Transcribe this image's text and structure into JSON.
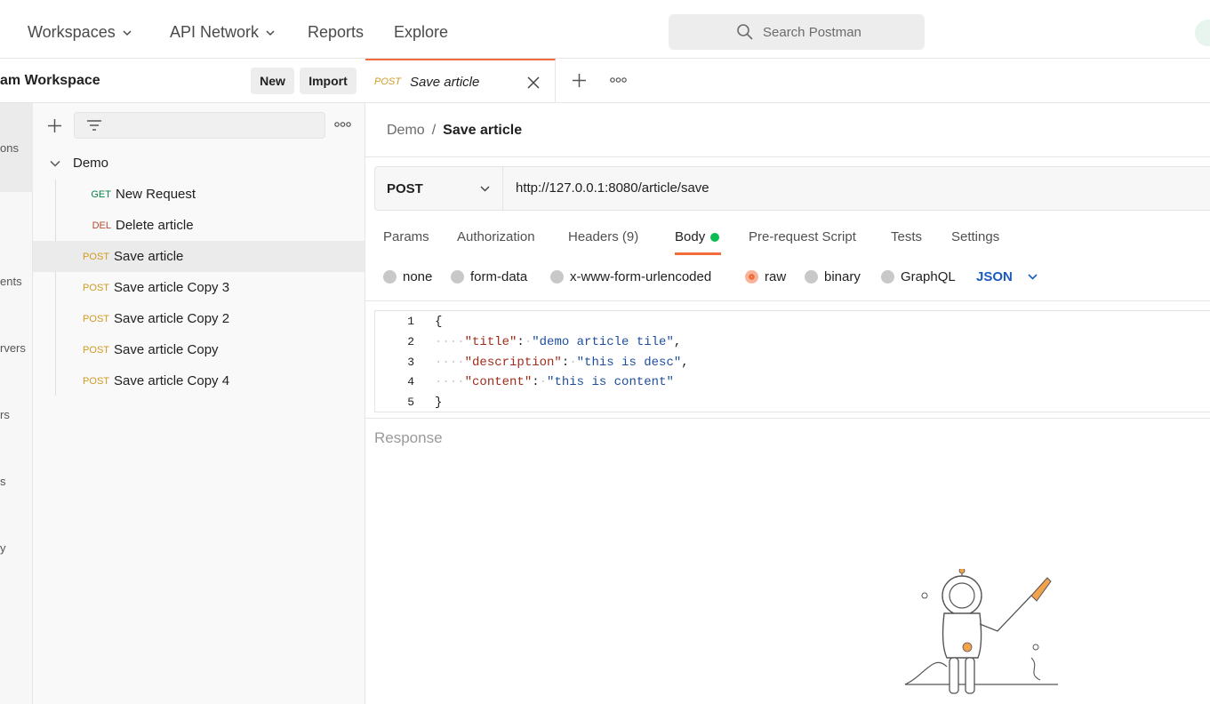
{
  "topnav": {
    "items": [
      {
        "label": "Workspaces",
        "dropdown": true
      },
      {
        "label": "API Network",
        "dropdown": true
      },
      {
        "label": "Reports",
        "dropdown": false
      },
      {
        "label": "Explore",
        "dropdown": false
      }
    ],
    "search_placeholder": "Search Postman"
  },
  "workspace": {
    "title": "am Workspace",
    "new_label": "New",
    "import_label": "Import"
  },
  "rail": {
    "labels": [
      "ons",
      "ents",
      "rvers",
      "rs",
      "s",
      "y"
    ]
  },
  "tree": {
    "collection": "Demo",
    "requests": [
      {
        "method": "GET",
        "name": "New Request",
        "selected": false
      },
      {
        "method": "DEL",
        "name": "Delete article",
        "selected": false
      },
      {
        "method": "POST",
        "name": "Save article",
        "selected": true
      },
      {
        "method": "POST",
        "name": "Save article Copy 3",
        "selected": false
      },
      {
        "method": "POST",
        "name": "Save article Copy 2",
        "selected": false
      },
      {
        "method": "POST",
        "name": "Save article Copy",
        "selected": false
      },
      {
        "method": "POST",
        "name": "Save article Copy 4",
        "selected": false
      }
    ]
  },
  "open_tab": {
    "method": "POST",
    "name": "Save article"
  },
  "breadcrumb": {
    "parent": "Demo",
    "separator": "/",
    "current": "Save article"
  },
  "request": {
    "method": "POST",
    "url": "http://127.0.0.1:8080/article/save"
  },
  "request_tabs": [
    "Params",
    "Authorization",
    "Headers (9)",
    "Body",
    "Pre-request Script",
    "Tests",
    "Settings"
  ],
  "active_request_tab": "Body",
  "body_modes": [
    "none",
    "form-data",
    "x-www-form-urlencoded",
    "raw",
    "binary",
    "GraphQL"
  ],
  "active_body_mode": "raw",
  "body_language": "JSON",
  "editor": {
    "line_numbers": [
      "1",
      "2",
      "3",
      "4",
      "5"
    ],
    "lines": [
      {
        "parts": [
          {
            "t": "p",
            "v": "{"
          }
        ]
      },
      {
        "parts": [
          {
            "t": "w",
            "v": "····"
          },
          {
            "t": "k",
            "v": "\"title\""
          },
          {
            "t": "p",
            "v": ":"
          },
          {
            "t": "w",
            "v": "·"
          },
          {
            "t": "s",
            "v": "\"demo article tile\""
          },
          {
            "t": "p",
            "v": ","
          }
        ]
      },
      {
        "parts": [
          {
            "t": "w",
            "v": "····"
          },
          {
            "t": "k",
            "v": "\"description\""
          },
          {
            "t": "p",
            "v": ":"
          },
          {
            "t": "w",
            "v": "·"
          },
          {
            "t": "s",
            "v": "\"this is desc\""
          },
          {
            "t": "p",
            "v": ","
          }
        ]
      },
      {
        "parts": [
          {
            "t": "w",
            "v": "····"
          },
          {
            "t": "k",
            "v": "\"content\""
          },
          {
            "t": "p",
            "v": ":"
          },
          {
            "t": "w",
            "v": "·"
          },
          {
            "t": "s",
            "v": "\"this is content\""
          }
        ]
      },
      {
        "parts": [
          {
            "t": "p",
            "v": "}"
          }
        ]
      }
    ]
  },
  "response_label": "Response",
  "colors": {
    "accent": "#f26b3a",
    "get": "#0c7b45",
    "del": "#b64a2f",
    "post": "#d09b22",
    "json_link": "#1a5bbf",
    "body_dot": "#0cbb52"
  }
}
